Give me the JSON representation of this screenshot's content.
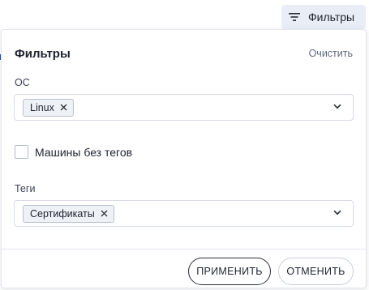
{
  "toolbar": {
    "filters_button_label": "Фильтры",
    "filters_icon": "filter-lines-icon"
  },
  "panel": {
    "title": "Фильтры",
    "clear_label": "Очистить",
    "os_filter": {
      "label": "ОС",
      "selected": [
        "Linux"
      ],
      "remove_icon": "close-icon",
      "dropdown_icon": "chevron-down-icon"
    },
    "untagged_checkbox": {
      "label": "Машины без тегов",
      "checked": false
    },
    "tags_filter": {
      "label": "Теги",
      "selected": [
        "Сертификаты"
      ],
      "remove_icon": "close-icon",
      "dropdown_icon": "chevron-down-icon"
    },
    "apply_label": "ПРИМЕНИТЬ",
    "cancel_label": "ОТМЕНИТЬ"
  },
  "colors": {
    "toggle_background": "#e9edf5",
    "chip_background": "#eef1f6",
    "text": "#1f2330",
    "muted_text": "#5f6a82",
    "border": "#d7dbe3"
  }
}
